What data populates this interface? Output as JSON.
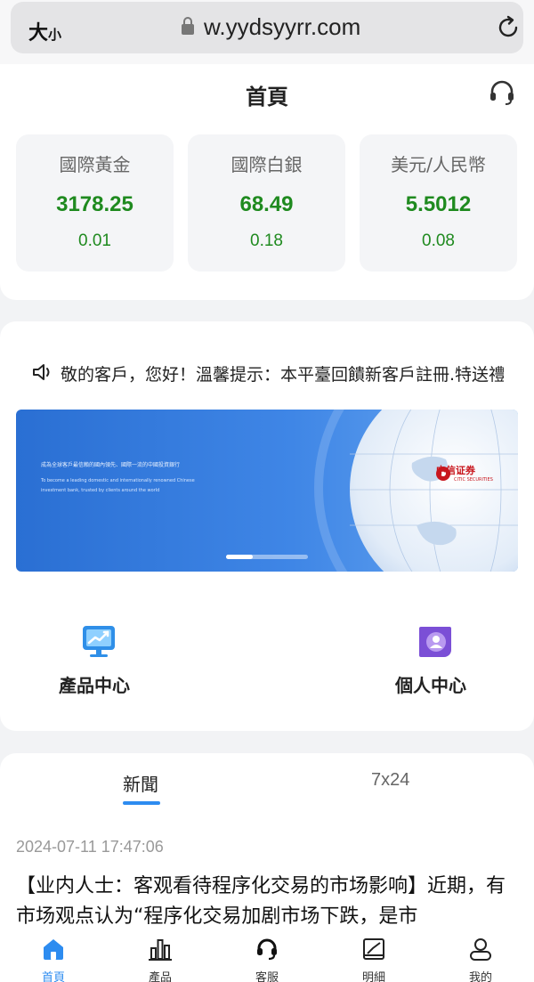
{
  "browser": {
    "text_size_label": "大",
    "text_size_small": "小",
    "url": "w.yydsyyrr.com"
  },
  "header": {
    "title": "首頁"
  },
  "tickers": [
    {
      "name": "國際黃金",
      "price": "3178.25",
      "change": "0.01"
    },
    {
      "name": "國際白銀",
      "price": "68.49",
      "change": "0.18"
    },
    {
      "name": "美元/人民幣",
      "price": "5.5012",
      "change": "0.08"
    }
  ],
  "notice": {
    "text": "敬的客戶，您好！溫馨提示：本平臺回饋新客戶註冊.特送禮"
  },
  "banner": {
    "line1": "成為全球客戶最信賴的國內領先、國際一流的中國投資銀行",
    "line2a": "To become a leading domestic and internationally renowned Chinese",
    "line2b": "investment bank, trusted by clients around the world",
    "logo": "中信证券",
    "logo_sub": "CITIC SECURITIES",
    "slide_progress": 0.33
  },
  "menu": [
    {
      "label": "產品中心",
      "icon": "monitor-chart-icon"
    },
    {
      "label": "個人中心",
      "icon": "user-badge-icon"
    }
  ],
  "news": {
    "tabs": [
      "新聞",
      "7x24"
    ],
    "active_tab": 0,
    "time": "2024-07-11 17:47:06",
    "headline": "【业内人士：客观看待程序化交易的市场影响】近期，有市场观点认为“程序化交易加剧市场下跌，是市"
  },
  "tabbar": [
    {
      "label": "首頁",
      "icon": "home-icon",
      "active": true
    },
    {
      "label": "產品",
      "icon": "bar-chart-icon",
      "active": false
    },
    {
      "label": "客服",
      "icon": "headset-icon",
      "active": false
    },
    {
      "label": "明細",
      "icon": "ledger-icon",
      "active": false
    },
    {
      "label": "我的",
      "icon": "person-icon",
      "active": false
    }
  ],
  "colors": {
    "accent": "#2d8cf0",
    "up": "#1f8a1f",
    "banner_blue": "#2a6fd3"
  }
}
